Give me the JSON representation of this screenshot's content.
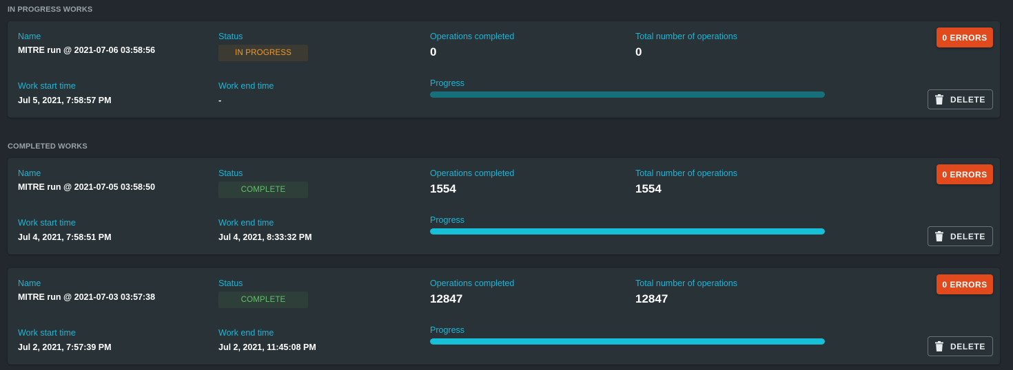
{
  "sections": {
    "in_progress": "IN PROGRESS WORKS",
    "completed": "COMPLETED WORKS"
  },
  "labels": {
    "name": "Name",
    "status": "Status",
    "ops_completed": "Operations completed",
    "ops_total": "Total number of operations",
    "start": "Work start time",
    "end": "Work end time",
    "progress": "Progress"
  },
  "buttons": {
    "errors": "0 ERRORS",
    "delete": "DELETE"
  },
  "icons": {
    "delete": "trash-icon"
  },
  "colors": {
    "accent": "#1eb6d6",
    "in_progress": "#f29a2a",
    "complete": "#5fc466",
    "error_button": "#e04a1d",
    "progress_fill": "#17bfd8",
    "progress_track": "#15707c"
  },
  "works": [
    {
      "name": "MITRE run @ 2021-07-06 03:58:56",
      "status": "IN PROGRESS",
      "ops_completed": "0",
      "ops_total": "0",
      "start": "Jul 5, 2021, 7:58:57 PM",
      "end": "-",
      "progress": 0
    },
    {
      "name": "MITRE run @ 2021-07-05 03:58:50",
      "status": "COMPLETE",
      "ops_completed": "1554",
      "ops_total": "1554",
      "start": "Jul 4, 2021, 7:58:51 PM",
      "end": "Jul 4, 2021, 8:33:32 PM",
      "progress": 1
    },
    {
      "name": "MITRE run @ 2021-07-03 03:57:38",
      "status": "COMPLETE",
      "ops_completed": "12847",
      "ops_total": "12847",
      "start": "Jul 2, 2021, 7:57:39 PM",
      "end": "Jul 2, 2021, 11:45:08 PM",
      "progress": 1
    }
  ]
}
